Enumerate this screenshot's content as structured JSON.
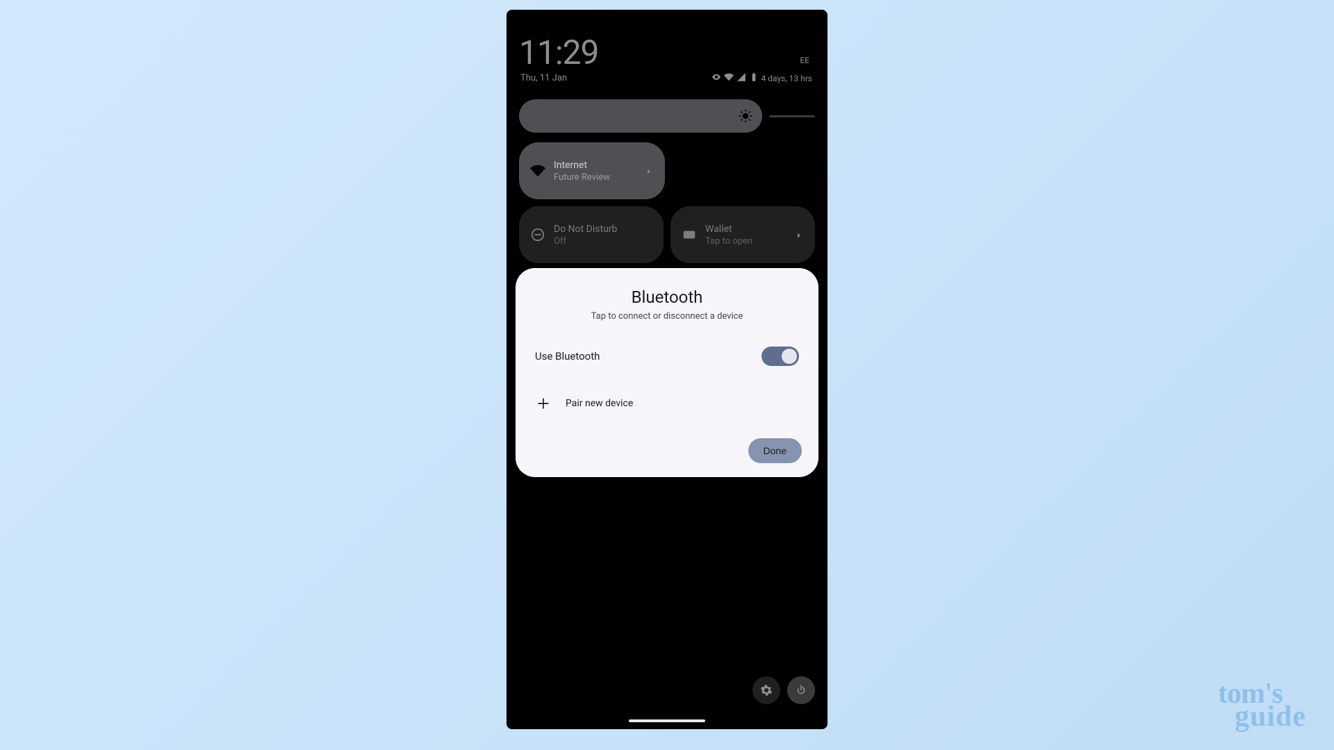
{
  "status": {
    "time": "11:29",
    "carrier": "EE",
    "date": "Thu, 11 Jan",
    "battery_remaining": "4 days, 13 hrs"
  },
  "tiles": {
    "internet": {
      "title": "Internet",
      "subtitle": "Future Review"
    },
    "dnd": {
      "title": "Do Not Disturb",
      "subtitle": "Off"
    },
    "wallet": {
      "title": "Wallet",
      "subtitle": "Tap to open"
    }
  },
  "dialog": {
    "title": "Bluetooth",
    "subtitle": "Tap to connect or disconnect a device",
    "toggle_label": "Use Bluetooth",
    "toggle_on": true,
    "pair_label": "Pair new device",
    "done_label": "Done"
  },
  "watermark": {
    "line1": "tom's",
    "line2": "guide"
  }
}
